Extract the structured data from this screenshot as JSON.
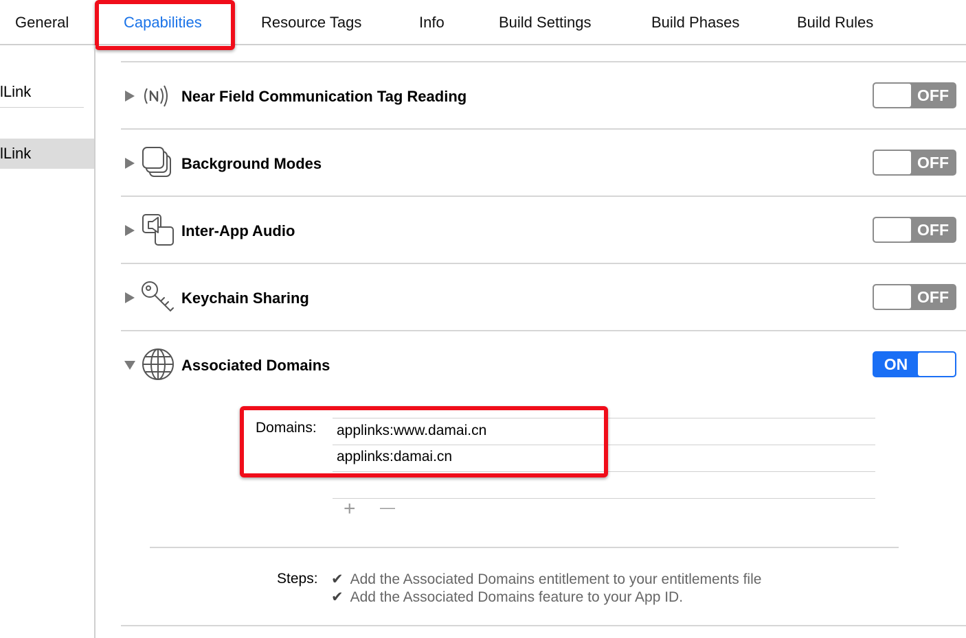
{
  "tabs": {
    "general": "General",
    "capabilities": "Capabilities",
    "resource_tags": "Resource Tags",
    "info": "Info",
    "build_settings": "Build Settings",
    "build_phases": "Build Phases",
    "build_rules": "Build Rules",
    "selected": "Capabilities"
  },
  "sidebar": {
    "items": [
      {
        "label": "lLink"
      },
      {
        "label": "lLink",
        "selected": true
      }
    ]
  },
  "capabilities": [
    {
      "title": "Near Field Communication Tag Reading",
      "icon": "nfc-icon",
      "state": "OFF",
      "expanded": false
    },
    {
      "title": "Background Modes",
      "icon": "background-modes-icon",
      "state": "OFF",
      "expanded": false
    },
    {
      "title": "Inter-App Audio",
      "icon": "inter-app-audio-icon",
      "state": "OFF",
      "expanded": false
    },
    {
      "title": "Keychain Sharing",
      "icon": "key-icon",
      "state": "OFF",
      "expanded": false
    },
    {
      "title": "Associated Domains",
      "icon": "globe-icon",
      "state": "ON",
      "expanded": true
    }
  ],
  "associated_domains": {
    "domains_label": "Domains:",
    "domains": [
      "applinks:www.damai.cn",
      "applinks:damai.cn"
    ],
    "add_symbol": "+",
    "remove_symbol": "—",
    "steps_label": "Steps:",
    "check_symbol": "✔",
    "steps": [
      "Add the Associated Domains entitlement to your entitlements file",
      "Add the Associated Domains feature to your App ID."
    ]
  },
  "colors": {
    "accent": "#1a6ff5",
    "tab_selected": "#1a73e8",
    "switch_off": "#8c8c8c",
    "annotation_red": "#f00d1a"
  }
}
